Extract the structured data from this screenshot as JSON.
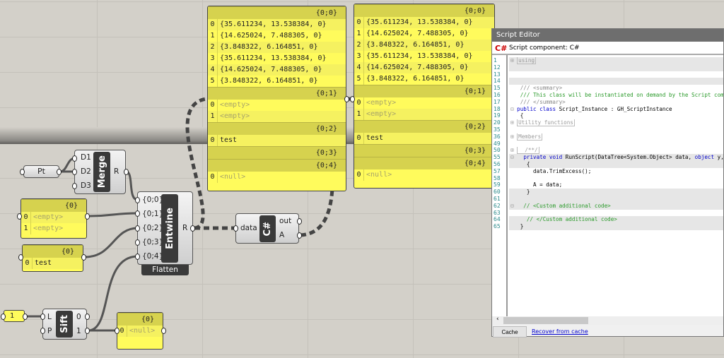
{
  "panel_main": {
    "branches": [
      {
        "path": "{0;0}",
        "items": [
          "{35.611234, 13.538384, 0}",
          "{14.625024, 7.488305, 0}",
          "{3.848322, 6.164851, 0}",
          "{35.611234, 13.538384, 0}",
          "{14.625024, 7.488305, 0}",
          "{3.848322, 6.164851, 0}"
        ]
      },
      {
        "path": "{0;1}",
        "items": [
          "<empty>",
          "<empty>"
        ]
      },
      {
        "path": "{0;2}",
        "items": [
          "test"
        ]
      },
      {
        "path": "{0;3}",
        "items": []
      },
      {
        "path": "{0;4}",
        "items": [
          "<null>"
        ]
      }
    ]
  },
  "panel_out": {
    "branches": [
      {
        "path": "{0;0}",
        "items": [
          "{35.611234, 13.538384, 0}",
          "{14.625024, 7.488305, 0}",
          "{3.848322, 6.164851, 0}",
          "{35.611234, 13.538384, 0}",
          "{14.625024, 7.488305, 0}",
          "{3.848322, 6.164851, 0}"
        ]
      },
      {
        "path": "{0;1}",
        "items": [
          "<empty>",
          "<empty>"
        ]
      },
      {
        "path": "{0;2}",
        "items": [
          "test"
        ]
      },
      {
        "path": "{0;3}",
        "items": []
      },
      {
        "path": "{0;4}",
        "items": [
          "<null>"
        ]
      }
    ]
  },
  "panel_empty": {
    "path": "{0}",
    "items": [
      "<empty>",
      "<empty>"
    ]
  },
  "panel_test": {
    "path": "{0}",
    "items": [
      "test"
    ]
  },
  "panel_null": {
    "path": "{0}",
    "items": [
      "<null>"
    ]
  },
  "slider": {
    "value": "1"
  },
  "pt": {
    "label": "Pt"
  },
  "merge": {
    "name": "Merge",
    "inputs": [
      "D1",
      "D2",
      "D3"
    ],
    "output": "R"
  },
  "entwine": {
    "name": "Entwine",
    "inputs": [
      "{0;0}",
      "{0;1}",
      "{0;2}",
      "{0;3}",
      "{0;4}"
    ],
    "output": "R",
    "flag": "Flatten"
  },
  "csharp": {
    "name": "C#",
    "input": "data",
    "outputs": [
      "out",
      "A"
    ]
  },
  "sift": {
    "name": "Sift",
    "inputs": [
      "L",
      "P"
    ],
    "outputs": [
      "0",
      "1"
    ]
  },
  "editor": {
    "title": "Script Editor",
    "subtitle": "Script component: C#",
    "icon": "C#",
    "lines": [
      {
        "n": "1",
        "t": "using",
        "fold": true,
        "shade": true,
        "m": "+"
      },
      {
        "n": "12",
        "t": "",
        "shade": true
      },
      {
        "n": "13",
        "t": ""
      },
      {
        "n": "14",
        "t": "",
        "shade": true
      },
      {
        "n": "15",
        "t": "/// <summary>",
        "c": "cmg"
      },
      {
        "n": "16",
        "t": "/// This class will be instantiated on demand by the Script component.",
        "c": "cm"
      },
      {
        "n": "17",
        "t": "/// </summary>",
        "c": "cmg"
      },
      {
        "n": "18",
        "t": "public class Script_Instance : GH_ScriptInstance",
        "c": "kwl",
        "m": "-"
      },
      {
        "n": "19",
        "t": "{"
      },
      {
        "n": "20",
        "t": "Utility functions",
        "fold": true,
        "m": "+"
      },
      {
        "n": "35",
        "t": ""
      },
      {
        "n": "36",
        "t": "Members",
        "fold": true,
        "m": "+"
      },
      {
        "n": "49",
        "t": ""
      },
      {
        "n": "50",
        "t": "  /**/",
        "fold": true,
        "m": "+"
      },
      {
        "n": "55",
        "t": "  private void RunScript(DataTree<System.Object> data, object y, ref object A)",
        "c": "kwl",
        "m": "-",
        "shade": true
      },
      {
        "n": "56",
        "t": "  {",
        "shade": true
      },
      {
        "n": "57",
        "t": "    data.TrimExcess();"
      },
      {
        "n": "58",
        "t": ""
      },
      {
        "n": "59",
        "t": "    A = data;"
      },
      {
        "n": "60",
        "t": "  }",
        "shade": true
      },
      {
        "n": "61",
        "t": "",
        "shade": true
      },
      {
        "n": "62",
        "t": "  // <Custom additional code>",
        "c": "cm",
        "m": "-",
        "shade": true
      },
      {
        "n": "63",
        "t": ""
      },
      {
        "n": "64",
        "t": "  // </Custom additional code>",
        "c": "cm",
        "shade": true
      },
      {
        "n": "65",
        "t": "}",
        "shade": true
      }
    ],
    "cache_button": "Cache",
    "recover_link": "Recover from cache"
  },
  "colors": {
    "panel": "#fffb5c",
    "panel_header": "#d6d24e",
    "canvas": "#d3d0c9"
  }
}
